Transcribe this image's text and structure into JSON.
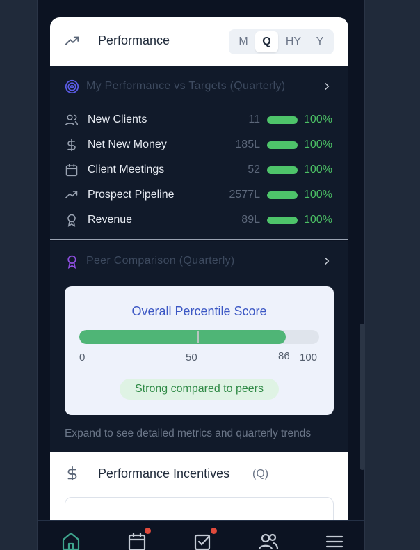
{
  "performance": {
    "title": "Performance",
    "periods": [
      "M",
      "Q",
      "HY",
      "Y"
    ],
    "active_period": "Q"
  },
  "targets": {
    "heading": "My Performance vs Targets (Quarterly)",
    "metrics": [
      {
        "label": "New Clients",
        "value": "11",
        "pct": "100%",
        "progress": 1.0,
        "icon": "users-icon"
      },
      {
        "label": "Net New Money",
        "value": "185L",
        "pct": "100%",
        "progress": 1.0,
        "icon": "dollar-icon"
      },
      {
        "label": "Client Meetings",
        "value": "52",
        "pct": "100%",
        "progress": 1.0,
        "icon": "calendar-icon"
      },
      {
        "label": "Prospect Pipeline",
        "value": "2577L",
        "pct": "100%",
        "progress": 1.0,
        "icon": "trending-up-icon"
      },
      {
        "label": "Revenue",
        "value": "89L",
        "pct": "100%",
        "progress": 1.0,
        "icon": "award-icon"
      }
    ]
  },
  "peer": {
    "heading": "Peer Comparison (Quarterly)",
    "score_title": "Overall Percentile Score",
    "score": 86,
    "scale": {
      "min": "0",
      "mid": "50",
      "max": "100"
    },
    "score_label": "86",
    "badge": "Strong compared to peers",
    "note": "Expand to see detailed metrics and quarterly trends"
  },
  "incentives": {
    "title": "Performance Incentives",
    "period": "(Q)"
  },
  "nav": {
    "items": [
      "home-icon",
      "calendar-icon",
      "tasks-icon",
      "clients-icon",
      "menu-icon"
    ]
  },
  "colors": {
    "accent_green": "#4ec46a",
    "score_blue": "#3b57c4",
    "notification_red": "#e04a3c",
    "nav_active": "#3fa58e"
  }
}
